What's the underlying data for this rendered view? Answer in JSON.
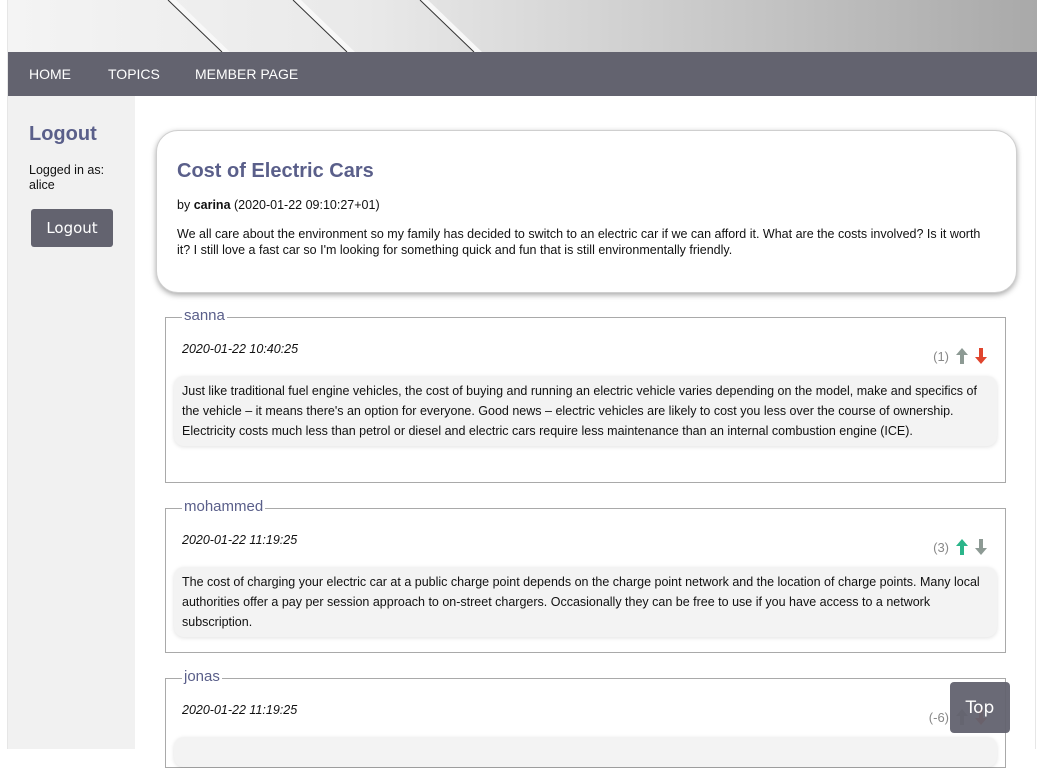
{
  "nav": {
    "items": [
      {
        "label": "HOME"
      },
      {
        "label": "TOPICS"
      },
      {
        "label": "MEMBER PAGE"
      }
    ]
  },
  "sidebar": {
    "title": "Logout",
    "status_label": "Logged in as:",
    "username": "alice",
    "logout_button": "Logout"
  },
  "topic": {
    "title": "Cost of Electric Cars",
    "by_label": "by",
    "author": "carina",
    "timestamp": "(2020-01-22 09:10:27+01)",
    "body": "We all care about the environment so my family has decided to switch to an electric car if we can afford it. What are the costs involved? Is it worth it? I still love a fast car so I'm looking for something quick and fun that is still environmentally friendly."
  },
  "replies": [
    {
      "author": "sanna",
      "date": "2020-01-22 10:40:25",
      "votes": "(1)",
      "up_active": false,
      "down_active": true,
      "body": "Just like traditional fuel engine vehicles, the cost of buying and running an electric vehicle varies depending on the model, make and specifics of the vehicle – it means there's an option for everyone. Good news – electric vehicles are likely to cost you less over the course of ownership. Electricity costs much less than petrol or diesel and electric cars require less maintenance than an internal combustion engine (ICE)."
    },
    {
      "author": "mohammed",
      "date": "2020-01-22 11:19:25",
      "votes": "(3)",
      "up_active": true,
      "down_active": false,
      "body": "The cost of charging your electric car at a public charge point depends on the charge point network and the location of charge points. Many local authorities offer a pay per session approach to on-street chargers. Occasionally they can be free to use if you have access to a network subscription."
    },
    {
      "author": "jonas",
      "date": "2020-01-22 11:19:25",
      "votes": "(-6)",
      "up_active": false,
      "down_active": true,
      "body": ""
    }
  ],
  "top_button": "Top",
  "colors": {
    "nav_bg": "#63636f",
    "accent": "#5a5f8a",
    "upvote_active": "#2bb58a",
    "downvote_active": "#e0452e",
    "vote_inactive": "#8d9a94"
  }
}
